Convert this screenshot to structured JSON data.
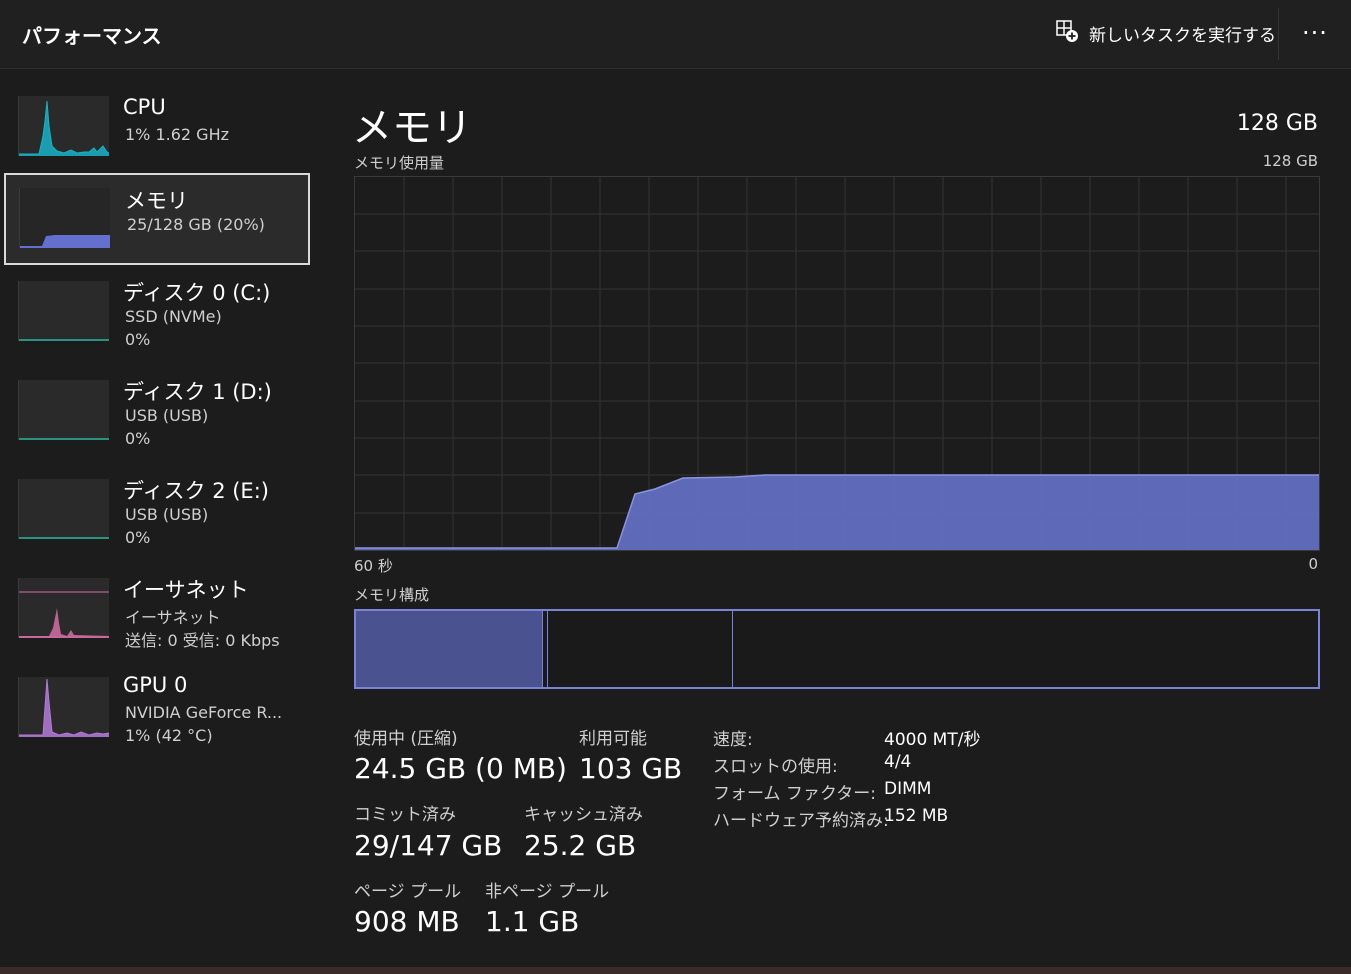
{
  "header": {
    "title": "パフォーマンス",
    "run_task_label": "新しいタスクを実行する",
    "run_task_icon": "new-task-icon",
    "more_label": "···"
  },
  "sidebar": {
    "items": [
      {
        "name": "CPU",
        "sub1": "1%  1.62 GHz",
        "sub2": "",
        "color": "#17b3c7"
      },
      {
        "name": "メモリ",
        "sub1": "25/128 GB (20%)",
        "sub2": "",
        "color": "#7b83d4"
      },
      {
        "name": "ディスク 0 (C:)",
        "sub1": "SSD (NVMe)",
        "sub2": "0%",
        "color": "#2bb49a"
      },
      {
        "name": "ディスク 1 (D:)",
        "sub1": "USB (USB)",
        "sub2": "0%",
        "color": "#2bb49a"
      },
      {
        "name": "ディスク 2 (E:)",
        "sub1": "USB (USB)",
        "sub2": "0%",
        "color": "#2bb49a"
      },
      {
        "name": "イーサネット",
        "sub1": "イーサネット",
        "sub2": "送信: 0 受信: 0 Kbps",
        "color": "#d46ea6"
      },
      {
        "name": "GPU 0",
        "sub1": "NVIDIA GeForce R...",
        "sub2": "1%  (42 °C)",
        "color": "#b57ad8"
      }
    ]
  },
  "main": {
    "title": "メモリ",
    "total": "128 GB",
    "graph_label": "メモリ使用量",
    "graph_max": "128 GB",
    "axis_left": "60 秒",
    "axis_right": "0",
    "composition_label": "メモリ構成",
    "stats": {
      "in_use_label": "使用中 (圧縮)",
      "in_use_value": "24.5 GB (0 MB)",
      "available_label": "利用可能",
      "available_value": "103 GB",
      "committed_label": "コミット済み",
      "committed_value": "29/147 GB",
      "cached_label": "キャッシュ済み",
      "cached_value": "25.2 GB",
      "paged_label": "ページ プール",
      "paged_value": "908 MB",
      "nonpaged_label": "非ページ プール",
      "nonpaged_value": "1.1 GB"
    },
    "details": [
      {
        "k": "速度:",
        "v": "4000 MT/秒"
      },
      {
        "k": "スロットの使用:",
        "v": "4/4"
      },
      {
        "k": "フォーム ファクター:",
        "v": "DIMM"
      },
      {
        "k": "ハードウェア予約済み:",
        "v": "152 MB"
      }
    ]
  },
  "colors": {
    "accent": "#7b83d4",
    "fill": "#5c68c4"
  }
}
